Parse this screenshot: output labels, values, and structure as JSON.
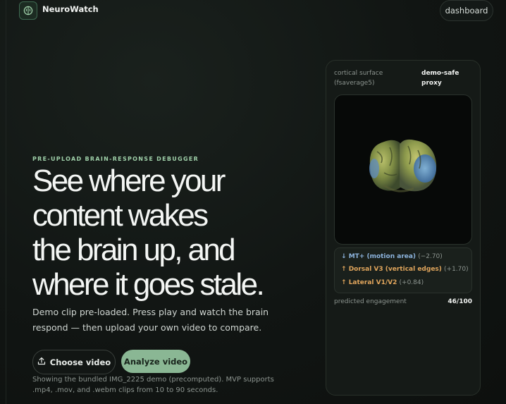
{
  "header": {
    "brand": "NeuroWatch",
    "dashboard_label": "dashboard"
  },
  "hero": {
    "eyebrow": "PRE-UPLOAD BRAIN-RESPONSE DEBUGGER",
    "headline_lines": [
      "See where your",
      "content wakes",
      "the brain up, and",
      "where it goes stale."
    ],
    "subtitle": "Demo clip pre-loaded. Press play and watch the brain respond — then upload your own video to compare.",
    "choose_label": "Choose video",
    "analyze_label": "Analyze video",
    "note": "Showing the bundled IMG_2225 demo (precomputed). MVP supports .mp4, .mov, and .webm clips from 10 to 90 seconds."
  },
  "card": {
    "surface_label": "cortical surface (fsaverage5)",
    "demo_label": "demo-safe proxy",
    "metrics": [
      {
        "arrow": "↓",
        "name": "MT+ (motion area)",
        "delta": "(−2.70)",
        "color": "#8db4de"
      },
      {
        "arrow": "↑",
        "name": "Dorsal V3 (vertical edges)",
        "delta": "(+1.70)",
        "color": "#e0a55c"
      },
      {
        "arrow": "↑",
        "name": "Lateral V1/V2",
        "delta": "(+0.84)",
        "color": "#e0a55c"
      }
    ],
    "engagement_label": "predicted engagement",
    "engagement_value": "46/100"
  },
  "icons": {
    "logo": "brain-icon",
    "upload": "upload-icon"
  },
  "colors": {
    "accent": "#8ab794",
    "eyebrow": "#9fd0a9",
    "background": "#111513"
  }
}
